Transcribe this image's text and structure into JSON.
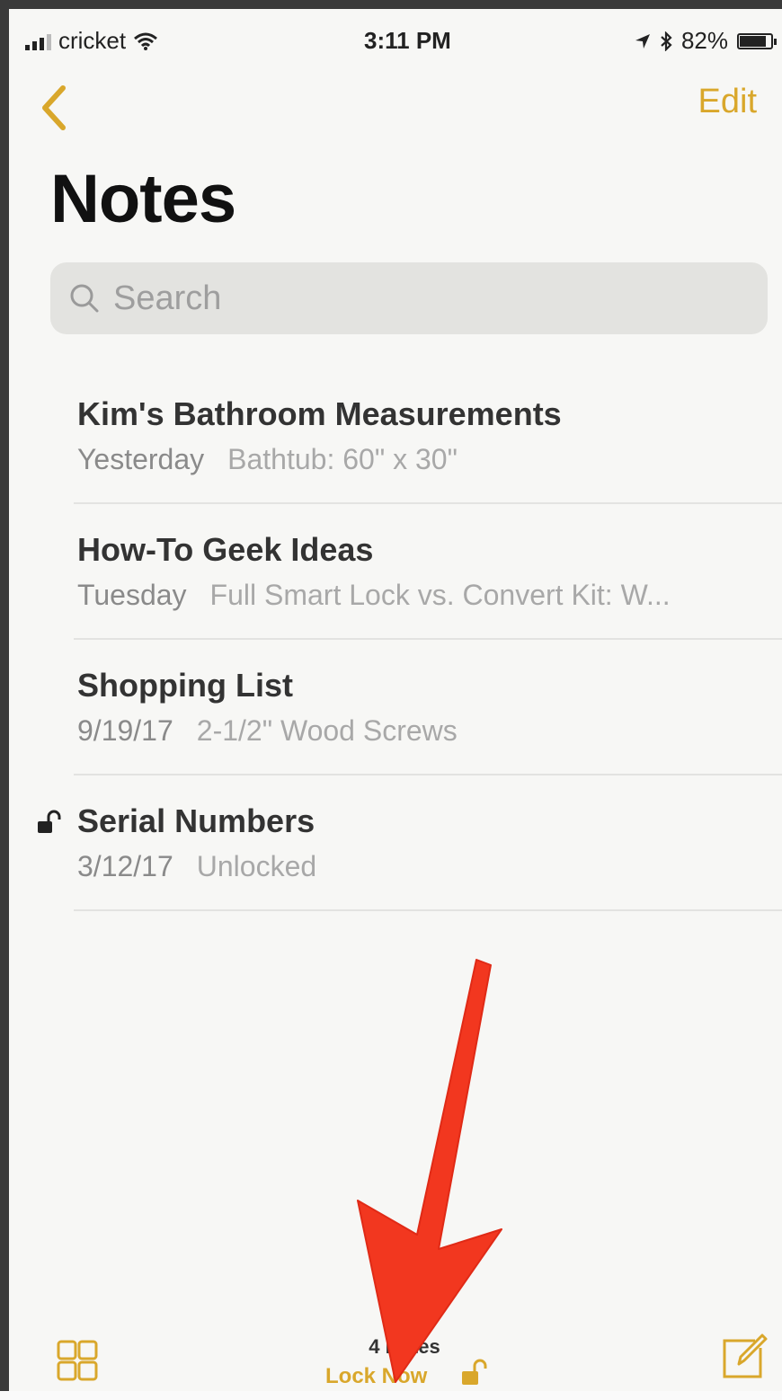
{
  "status_bar": {
    "carrier": "cricket",
    "time": "3:11 PM",
    "battery": "82%"
  },
  "nav": {
    "edit_label": "Edit"
  },
  "title": "Notes",
  "search": {
    "placeholder": "Search"
  },
  "notes": [
    {
      "title": "Kim's Bathroom Measurements",
      "date": "Yesterday",
      "preview": "Bathtub: 60\" x 30\""
    },
    {
      "title": "How-To Geek Ideas",
      "date": "Tuesday",
      "preview": "Full Smart Lock vs. Convert Kit: W..."
    },
    {
      "title": "Shopping List",
      "date": "9/19/17",
      "preview": "2-1/2\" Wood Screws"
    },
    {
      "title": "Serial Numbers",
      "date": "3/12/17",
      "preview": "Unlocked",
      "locked_icon": "unlocked-padlock-icon"
    }
  ],
  "toolbar": {
    "count": "4 Notes",
    "lock_now": "Lock Now"
  },
  "colors": {
    "accent": "#d9a72b",
    "annotation_arrow": "#f2371f"
  }
}
